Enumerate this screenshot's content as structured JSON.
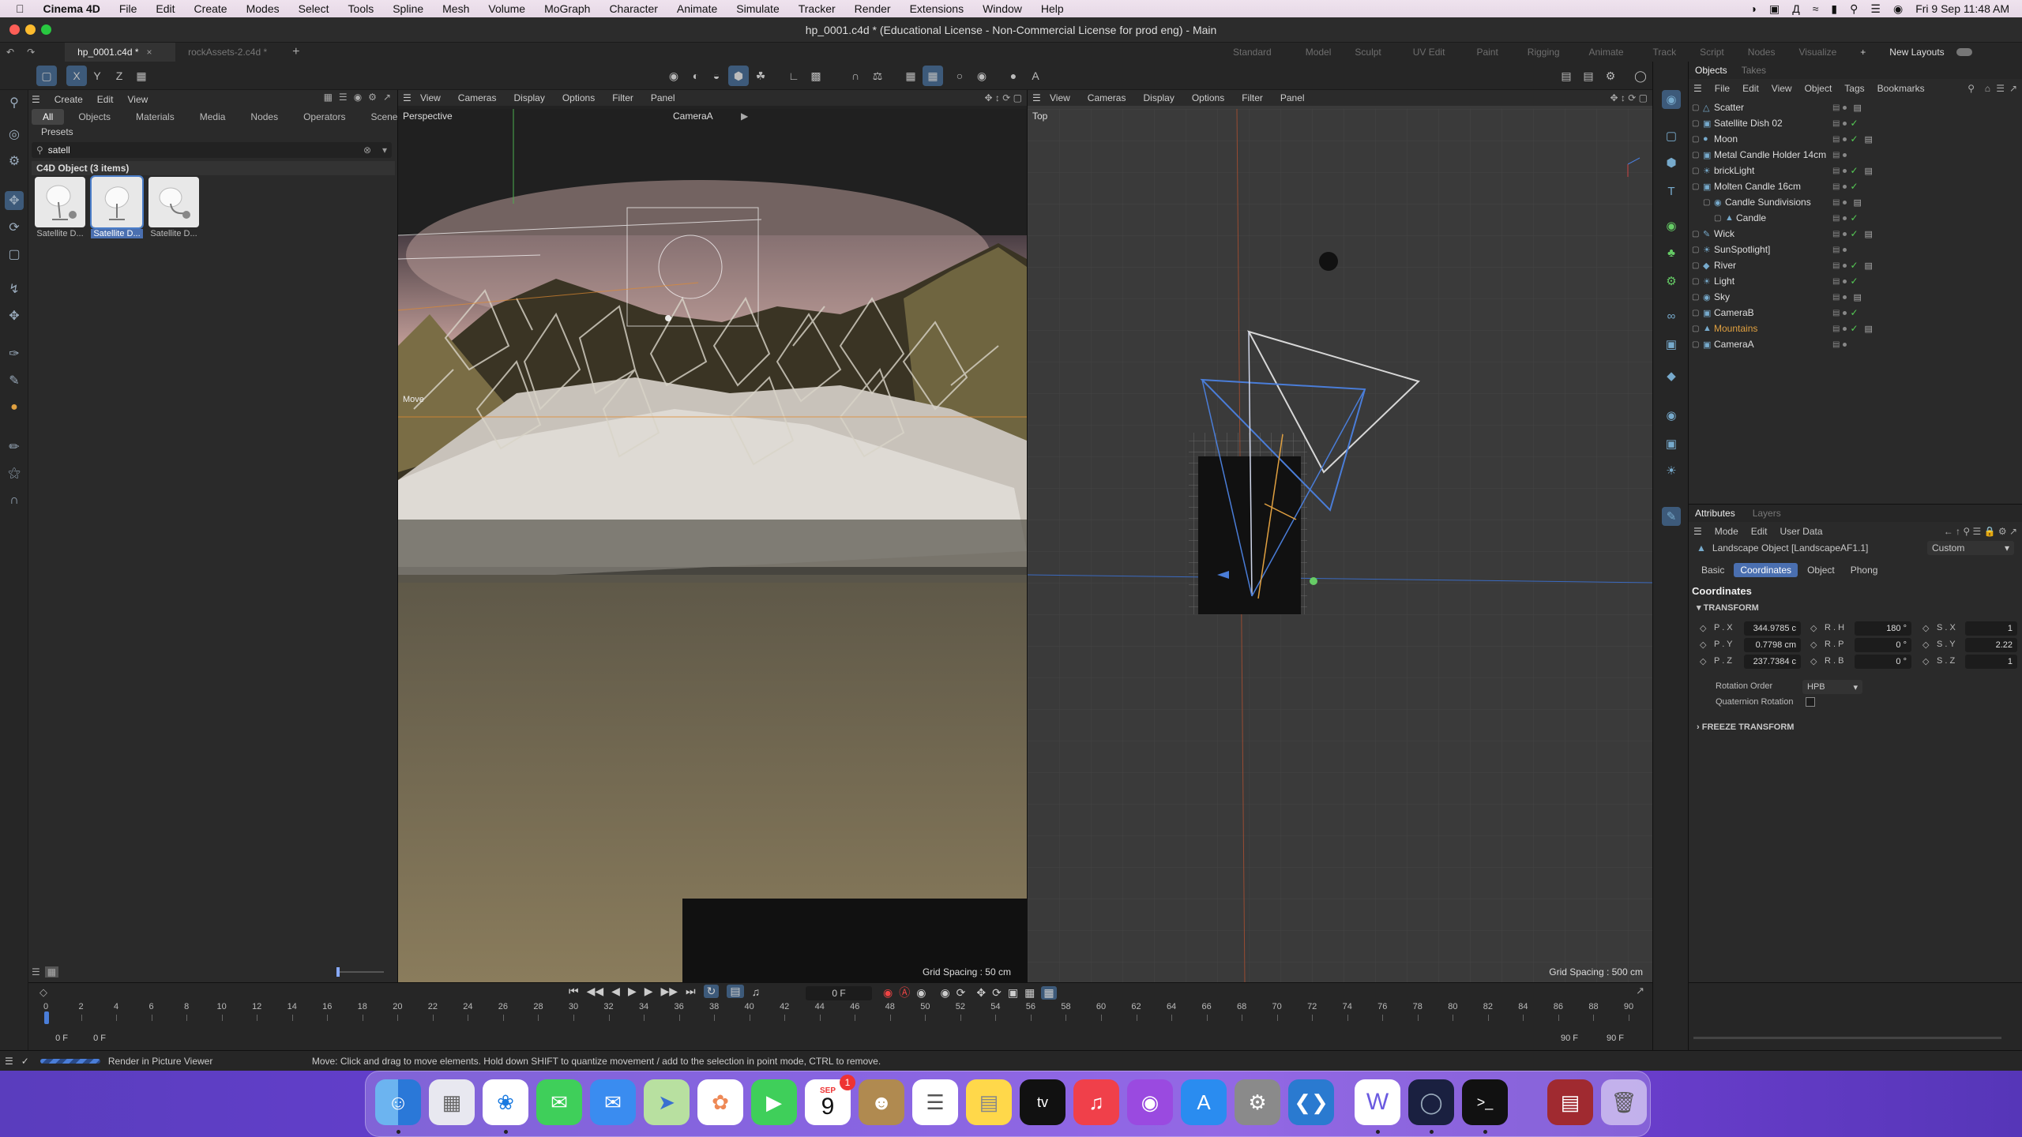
{
  "menubar": {
    "app": "Cinema 4D",
    "items": [
      "File",
      "Edit",
      "Create",
      "Modes",
      "Select",
      "Tools",
      "Spline",
      "Mesh",
      "Volume",
      "MoGraph",
      "Character",
      "Animate",
      "Simulate",
      "Tracker",
      "Render",
      "Extensions",
      "Window",
      "Help"
    ],
    "clock": "Fri 9 Sep  11:48 AM"
  },
  "window": {
    "title": "hp_0001.c4d * (Educational License - Non-Commercial License for prod eng) - Main"
  },
  "tabs": {
    "doc1": "hp_0001.c4d *",
    "doc2": "rockAssets-2.c4d *",
    "add": "+",
    "layouts": [
      "Standard",
      "Model",
      "Sculpt",
      "UV Edit",
      "Paint",
      "Rigging",
      "Animate",
      "Track",
      "Script",
      "Nodes",
      "Visualize"
    ],
    "new_layouts": "New Layouts"
  },
  "assets": {
    "menu": [
      "Create",
      "Edit",
      "View"
    ],
    "tabs": [
      "All",
      "Objects",
      "Materials",
      "Media",
      "Nodes",
      "Operators",
      "Scenes"
    ],
    "presets": "Presets",
    "search_value": "satell",
    "group_title": "C4D Object (3 items)",
    "items": [
      "Satellite D...",
      "Satellite D...",
      "Satellite D..."
    ]
  },
  "viewport_left": {
    "menu": [
      "View",
      "Cameras",
      "Display",
      "Options",
      "Filter",
      "Panel"
    ],
    "label": "Perspective",
    "camera": "CameraA",
    "move_hint": "Move",
    "grid_spacing": "Grid Spacing : 50 cm"
  },
  "viewport_right": {
    "menu": [
      "View",
      "Cameras",
      "Display",
      "Options",
      "Filter",
      "Panel"
    ],
    "label": "Top",
    "grid_spacing": "Grid Spacing : 500 cm"
  },
  "objects_panel": {
    "tabs": [
      "Objects",
      "Takes"
    ],
    "menu": [
      "File",
      "Edit",
      "View",
      "Object",
      "Tags",
      "Bookmarks"
    ],
    "rows": [
      {
        "name": "Scatter",
        "indent": 0
      },
      {
        "name": "Satellite Dish 02",
        "indent": 0
      },
      {
        "name": "Moon",
        "indent": 0
      },
      {
        "name": "Metal Candle Holder 14cm",
        "indent": 0
      },
      {
        "name": "brickLight",
        "indent": 0
      },
      {
        "name": "Molten Candle 16cm",
        "indent": 0
      },
      {
        "name": "Candle Sundivisions",
        "indent": 1
      },
      {
        "name": "Candle",
        "indent": 2
      },
      {
        "name": "Wick",
        "indent": 0
      },
      {
        "name": "SunSpotlight]",
        "indent": 0
      },
      {
        "name": "River",
        "indent": 0
      },
      {
        "name": "Light",
        "indent": 0
      },
      {
        "name": "Sky",
        "indent": 0
      },
      {
        "name": "CameraB",
        "indent": 0
      },
      {
        "name": "Mountains",
        "indent": 0
      },
      {
        "name": "CameraA",
        "indent": 0
      }
    ],
    "highlight_color": "#e0a040"
  },
  "attributes": {
    "tabs": [
      "Attributes",
      "Layers"
    ],
    "menu": [
      "Mode",
      "Edit",
      "User Data"
    ],
    "object_title": "Landscape Object [LandscapeAF1.1]",
    "preset": "Custom",
    "subtabs": [
      "Basic",
      "Coordinates",
      "Object",
      "Phong"
    ],
    "section": "Coordinates",
    "transform": "TRANSFORM",
    "px_label": "P . X",
    "px": "344.9785 c",
    "py_label": "P . Y",
    "py": "0.7798 cm",
    "pz_label": "P . Z",
    "pz": "237.7384 c",
    "rh_label": "R . H",
    "rh": "180 °",
    "rp_label": "R . P",
    "rp": "0 °",
    "rb_label": "R . B",
    "rb": "0 °",
    "sx_label": "S . X",
    "sx": "1",
    "sy_label": "S . Y",
    "sy": "2.22",
    "sz_label": "S . Z",
    "sz": "1",
    "rotation_order_label": "Rotation Order",
    "rotation_order": "HPB",
    "quaternion_label": "Quaternion Rotation",
    "freeze": "FREEZE TRANSFORM"
  },
  "timeline": {
    "frame": "0 F",
    "start": "0 F",
    "start2": "0 F",
    "end": "90 F",
    "end2": "90 F",
    "ticks": [
      "0",
      "2",
      "4",
      "6",
      "8",
      "10",
      "12",
      "14",
      "16",
      "18",
      "20",
      "22",
      "24",
      "26",
      "28",
      "30",
      "32",
      "34",
      "36",
      "38",
      "40",
      "42",
      "44",
      "46",
      "48",
      "50",
      "52",
      "54",
      "56",
      "58",
      "60",
      "62",
      "64",
      "66",
      "68",
      "70",
      "72",
      "74",
      "76",
      "78",
      "80",
      "82",
      "84",
      "86",
      "88",
      "90"
    ]
  },
  "status": {
    "render": "Render in Picture Viewer",
    "hint": "Move: Click and drag to move elements. Hold down SHIFT to quantize movement / add to the selection in point mode, CTRL to remove."
  },
  "dock": {
    "calendar_month": "SEP",
    "calendar_day": "9",
    "calendar_badge": "1"
  }
}
